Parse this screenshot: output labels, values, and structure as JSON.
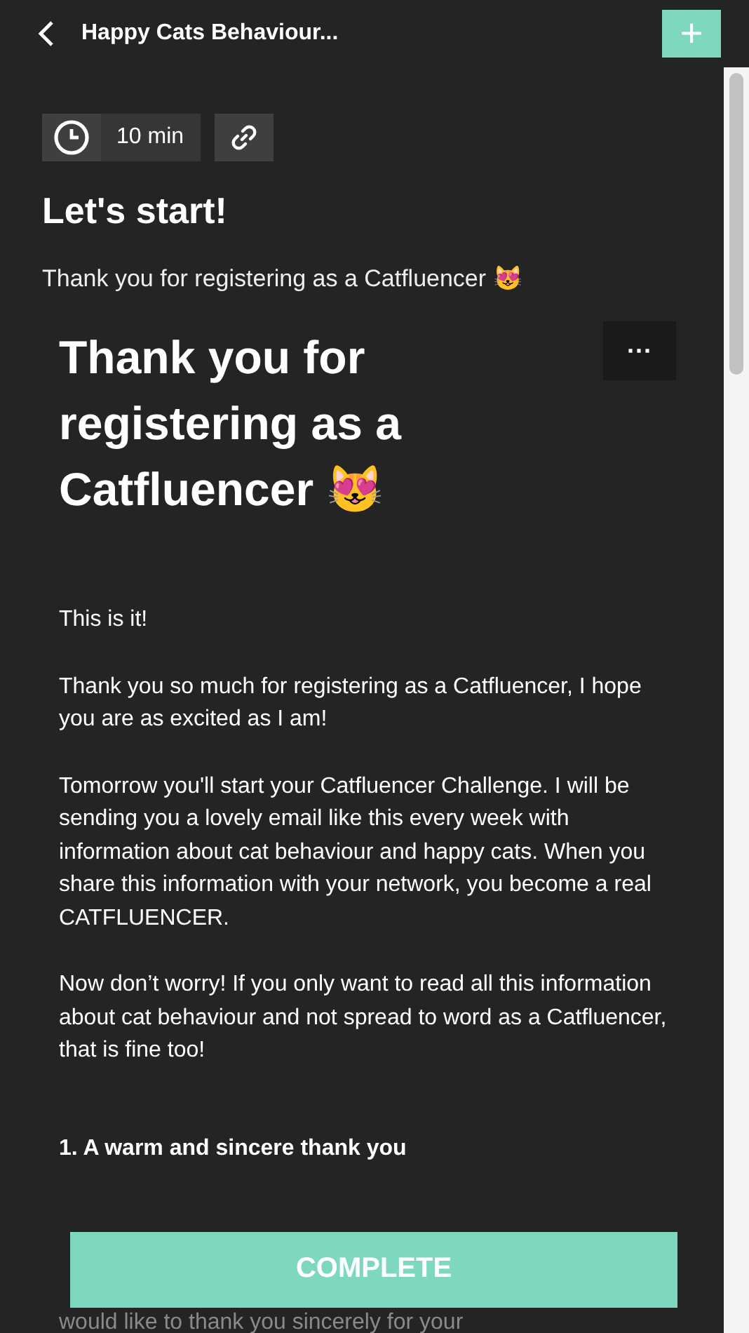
{
  "header": {
    "title": "Happy Cats Behaviour...",
    "add_button": "+"
  },
  "meta": {
    "duration": "10 min"
  },
  "lesson": {
    "title": "Let's start!",
    "subtitle": "Thank you for registering as a Catfluencer 😻"
  },
  "card": {
    "heading": "Thank you for registering as a Catfluencer 😻",
    "menu": "···",
    "paragraphs": [
      {
        "kind": "text",
        "text": "This is it!"
      },
      {
        "kind": "text",
        "text": "Thank you so much for registering as a Catfluencer, I hope you are as excited as I am!"
      },
      {
        "kind": "text",
        "text": "Tomorrow you'll start your Catfluencer Challenge. I will be sending you a lovely email like this every week with information about cat behaviour and happy cats. When you share this information with your network, you become a real CATFLUENCER."
      },
      {
        "kind": "text",
        "text": "Now don’t worry! If you only want to read all this information about cat behaviour and not spread to word as a Catfluencer, that is fine too!"
      },
      {
        "kind": "heading",
        "text": "1. A warm and sincere thank you"
      }
    ],
    "faded_line": "would like to thank you sincerely for your"
  },
  "complete_button": "COMPLETE"
}
